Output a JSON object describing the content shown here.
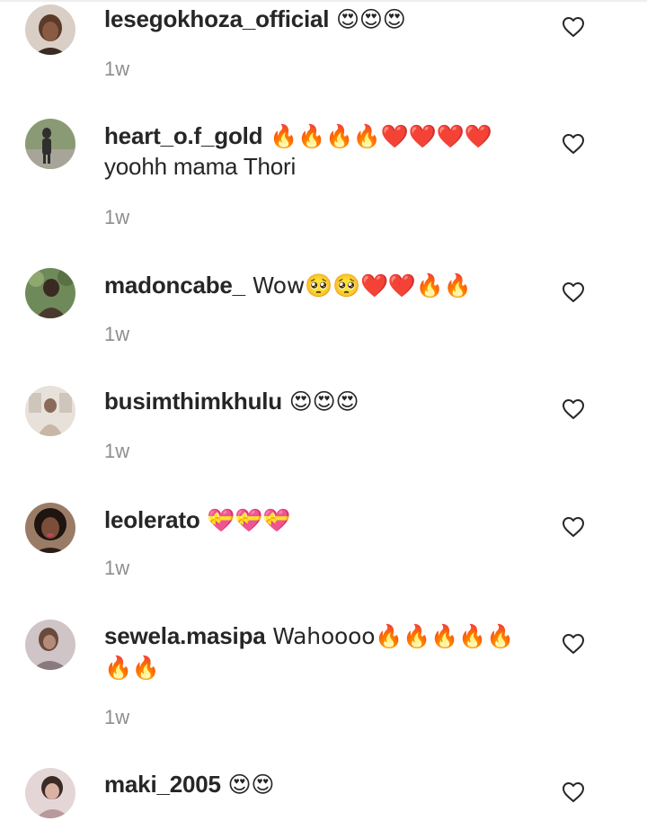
{
  "comments": [
    {
      "username": "lesegokhoza_official",
      "text": " 😍😍😍",
      "time": "1w",
      "avatar_color": "#5b3a2a",
      "avatar_bg": "#d9cfc6"
    },
    {
      "username": "heart_o.f_gold",
      "text": " 🔥🔥🔥🔥❤️❤️❤️❤️",
      "text2": "yoohh mama Thori",
      "time": "1w",
      "avatar_color": "#2f2f2f",
      "avatar_bg": "#7e8c6a"
    },
    {
      "username": "madoncabe_",
      "text": " Wow🥺🥺❤️❤️🔥🔥",
      "time": "1w",
      "avatar_color": "#3a2a22",
      "avatar_bg": "#6f8a5a"
    },
    {
      "username": "busimthimkhulu",
      "text": " 😍😍😍",
      "time": "1w",
      "avatar_color": "#c8b7a6",
      "avatar_bg": "#e7e1da"
    },
    {
      "username": "leolerato",
      "text": " 💝💝💝",
      "time": "1w",
      "avatar_color": "#2a1c16",
      "avatar_bg": "#9a7c66"
    },
    {
      "username": "sewela.masipa",
      "text": " Wahoooo🔥🔥🔥🔥🔥",
      "text2": "🔥🔥",
      "time": "1w",
      "avatar_color": "#6b4a3e",
      "avatar_bg": "#cfc4c6"
    },
    {
      "username": "maki_2005",
      "text": " 😍😍",
      "time": "",
      "avatar_color": "#3c2a25",
      "avatar_bg": "#e4d6d6"
    }
  ]
}
